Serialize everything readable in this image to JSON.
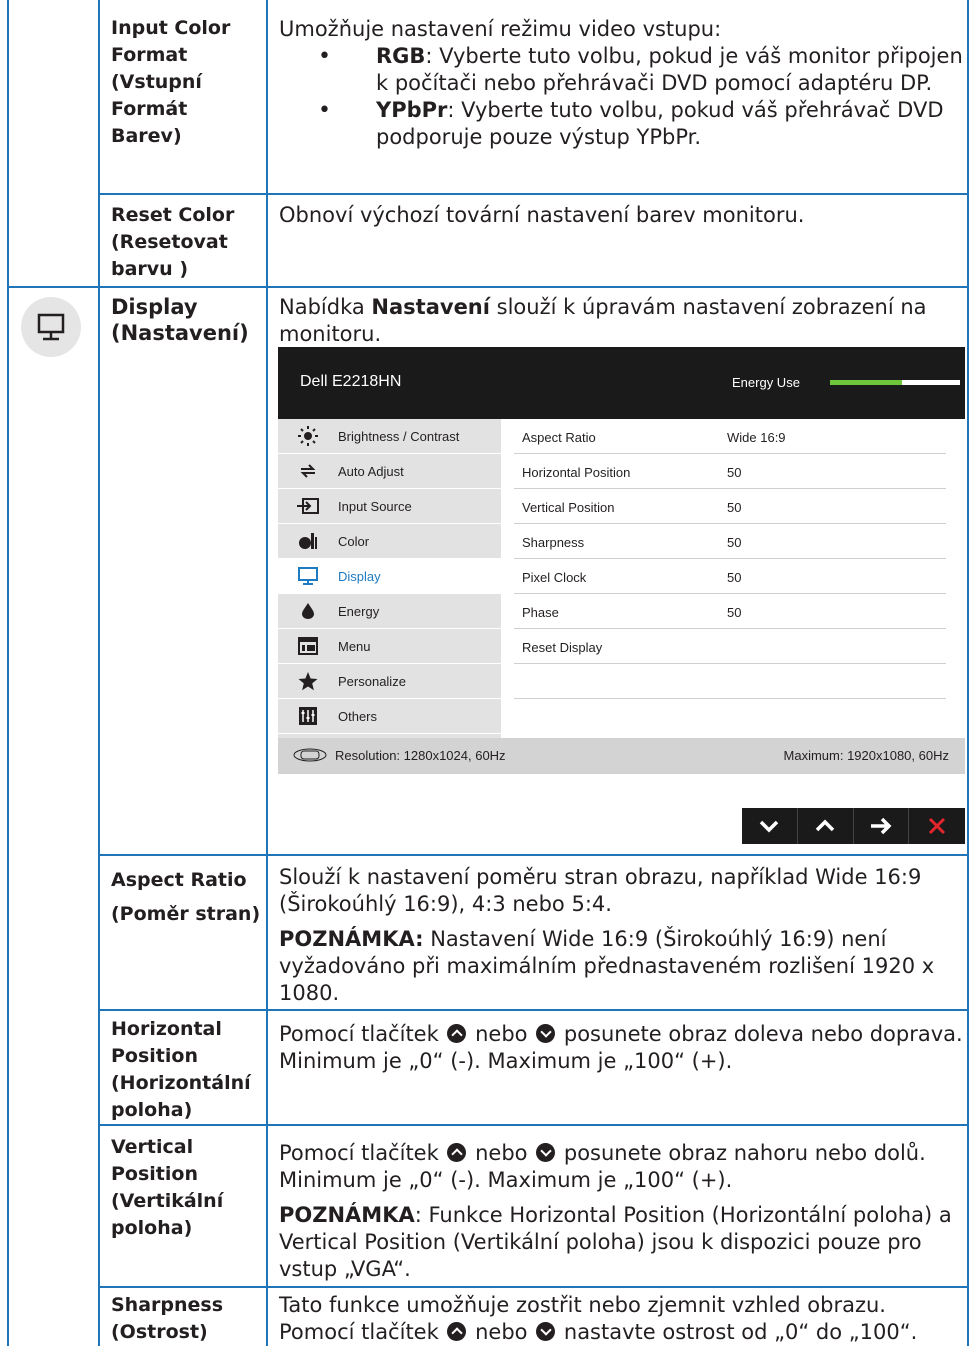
{
  "rows": {
    "input_color": {
      "label": "Input Color Format (Vstupní Formát Barev)",
      "intro": "Umožňuje nastavení režimu video vstupu:",
      "bullets": [
        {
          "term": "RGB",
          "text": ": Vyberte tuto volbu, pokud je váš monitor připojen k počítači nebo přehrávači DVD pomocí adaptéru DP."
        },
        {
          "term": "YPbPr",
          "text": ": Vyberte tuto volbu, pokud váš přehrávač DVD podporuje pouze výstup YPbPr."
        }
      ]
    },
    "reset_color": {
      "label": "Reset Color (Resetovat barvu )",
      "text": "Obnoví výchozí tovární nastavení barev monitoru."
    },
    "display": {
      "label": "Display (Nastavení)",
      "text_before": "Nabídka ",
      "text_bold": "Nastavení",
      "text_after": " slouží k úpravám nastavení zobrazení na monitoru."
    },
    "aspect_ratio": {
      "label": "Aspect Ratio (Poměr stran)",
      "text": "Slouží k nastavení poměru stran obrazu, například Wide 16:9 (Širokoúhlý 16:9), 4:3 nebo 5:4.",
      "note_label": "POZNÁMKA:",
      "note_text": " Nastavení Wide 16:9 (Širokoúhlý 16:9) není vyžadováno při maximálním přednastaveném rozlišení 1920 x 1080."
    },
    "horizontal": {
      "label": "Horizontal Position (Horizontální poloha)",
      "text_a": "Pomocí tlačítek ",
      "text_b": " nebo ",
      "text_c": " posunete obraz doleva nebo doprava. Minimum je „0“ (-). Maximum je „100“ (+)."
    },
    "vertical": {
      "label": "Vertical Position (Vertikální poloha)",
      "text_a": " Pomocí tlačítek ",
      "text_b": " nebo ",
      "text_c": " posunete obraz nahoru nebo dolů. Minimum je „0“ (-). Maximum je „100“ (+).",
      "note_label": "POZNÁMKA",
      "note_text": ": Funkce Horizontal Position (Horizontální poloha) a Vertical Position (Vertikální poloha) jsou k dispozici pouze pro vstup „VGA“."
    },
    "sharpness": {
      "label": "Sharpness (Ostrost)",
      "text": "Tato funkce umožňuje zostřit nebo zjemnit vzhled obrazu.",
      "text_a": "Pomocí tlačítek ",
      "text_b": " nebo ",
      "text_c": " nastavte ostrost od „0“ do „100“."
    }
  },
  "osd": {
    "model": "Dell E2218HN",
    "energy_label": "Energy Use",
    "energy_level": 0.55,
    "menu": [
      {
        "label": "Brightness / Contrast",
        "icon": "brightness-icon"
      },
      {
        "label": "Auto Adjust",
        "icon": "auto-adjust-icon"
      },
      {
        "label": "Input Source",
        "icon": "input-source-icon"
      },
      {
        "label": "Color",
        "icon": "color-icon"
      },
      {
        "label": "Display",
        "icon": "display-icon",
        "active": true
      },
      {
        "label": "Energy",
        "icon": "energy-icon"
      },
      {
        "label": "Menu",
        "icon": "menu-icon"
      },
      {
        "label": "Personalize",
        "icon": "star-icon"
      },
      {
        "label": "Others",
        "icon": "others-icon"
      }
    ],
    "settings": [
      {
        "key": "Aspect Ratio",
        "value": "Wide 16:9"
      },
      {
        "key": "Horizontal Position",
        "value": "50"
      },
      {
        "key": "Vertical Position",
        "value": "50"
      },
      {
        "key": "Sharpness",
        "value": "50"
      },
      {
        "key": "Pixel Clock",
        "value": "50"
      },
      {
        "key": "Phase",
        "value": "50"
      },
      {
        "key": "Reset Display",
        "value": ""
      },
      {
        "key": "",
        "value": ""
      }
    ],
    "resolution": "Resolution: 1280x1024, 60Hz",
    "maximum": "Maximum: 1920x1080, 60Hz",
    "accent": "#1f7bc1",
    "energy_color": "#6ec63a"
  },
  "colors": {
    "rule": "#1f75b8",
    "text": "#231f20"
  }
}
